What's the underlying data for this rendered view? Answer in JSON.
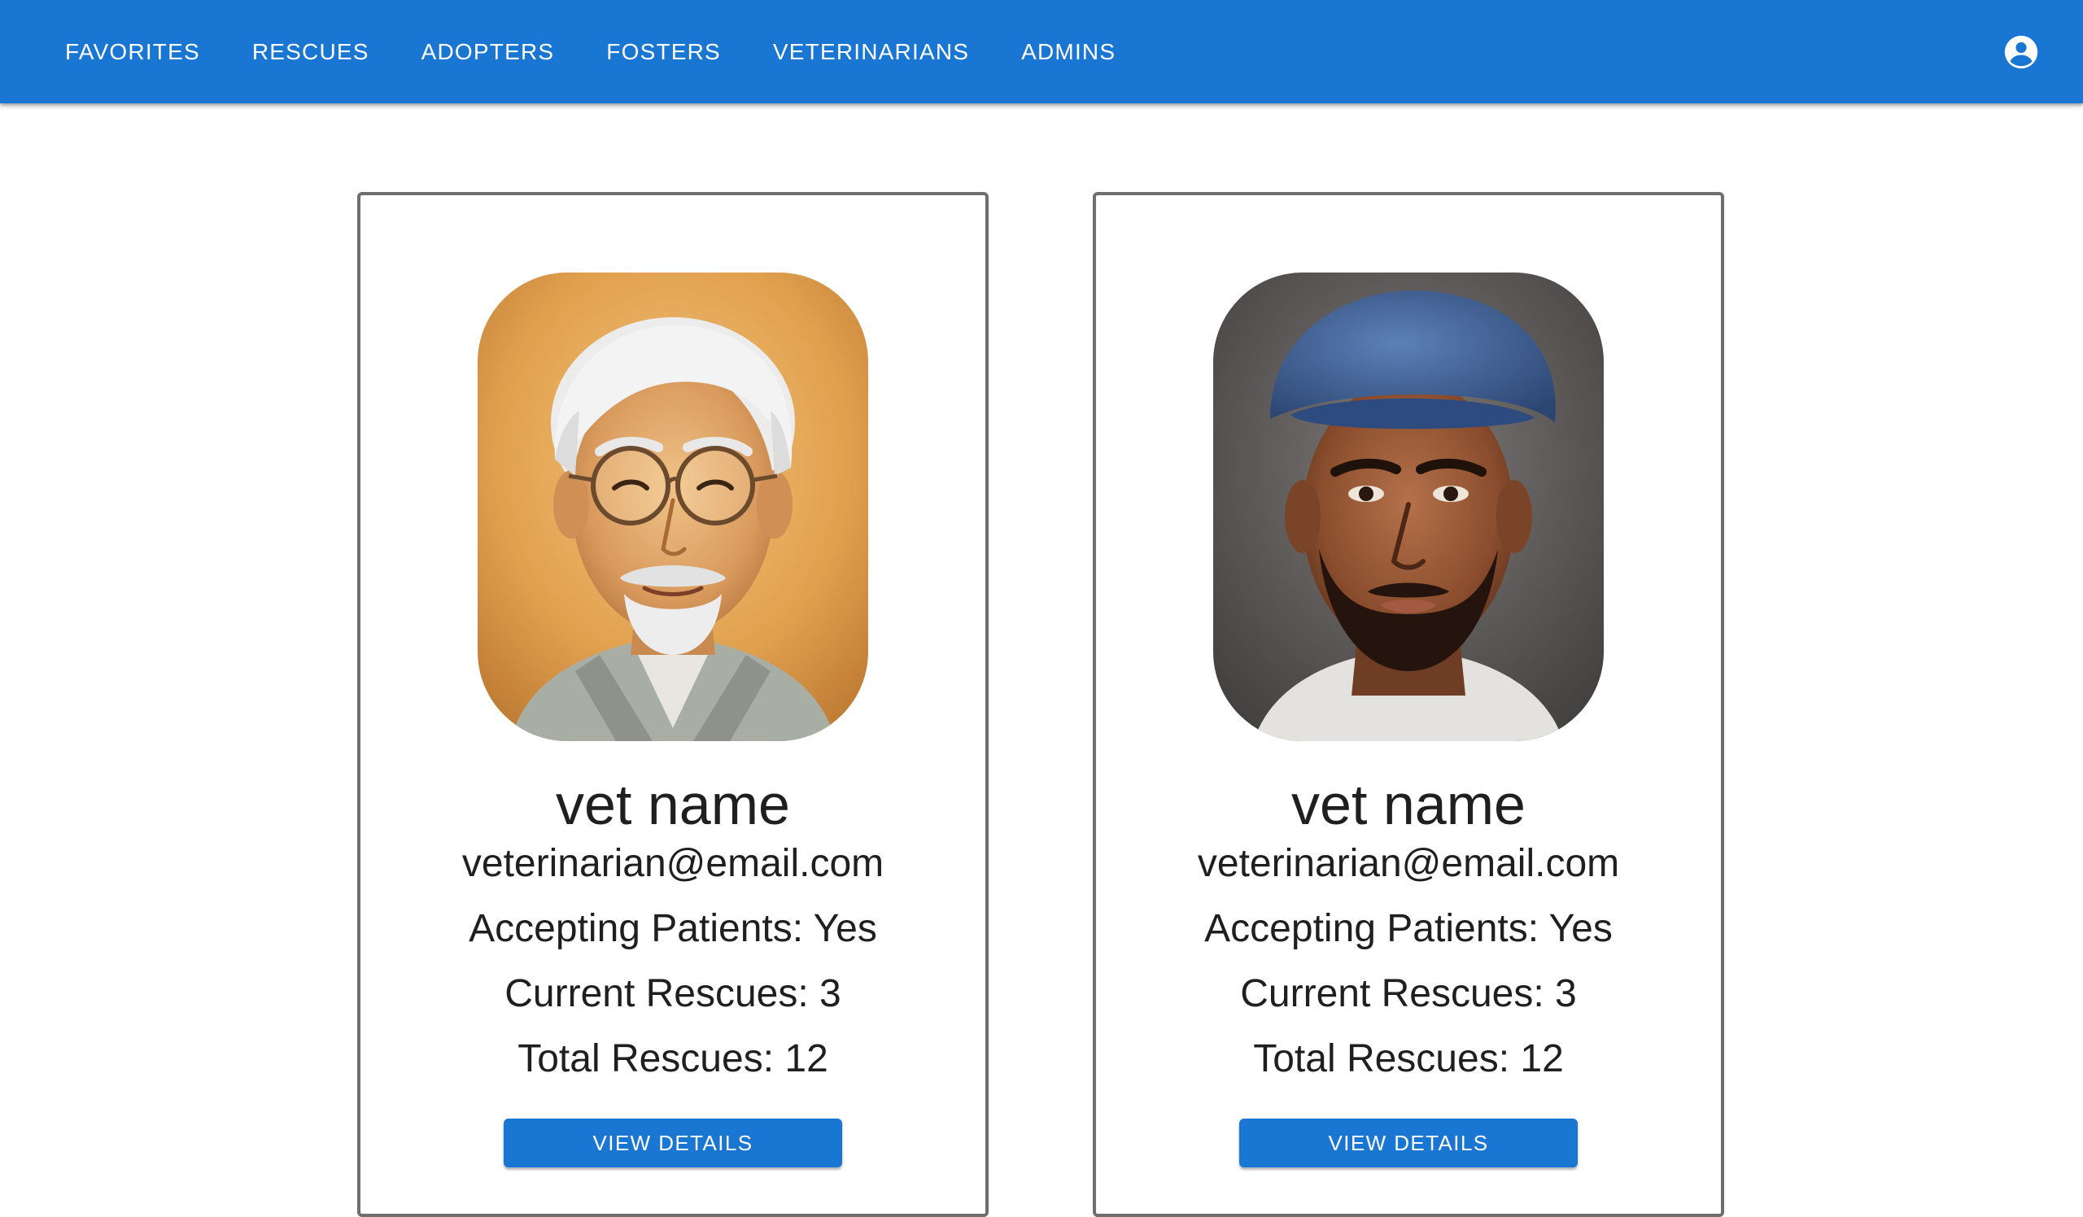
{
  "nav": {
    "items": [
      {
        "label": "FAVORITES"
      },
      {
        "label": "RESCUES"
      },
      {
        "label": "ADOPTERS"
      },
      {
        "label": "FOSTERS"
      },
      {
        "label": "VETERINARIANS"
      },
      {
        "label": "ADMINS"
      }
    ],
    "account_icon": "account-circle-icon"
  },
  "colors": {
    "primary": "#1976d2",
    "card_border": "#6e6e6e",
    "text": "#1f1f1f"
  },
  "vets": [
    {
      "photo": "older-man-with-glasses-portrait",
      "name": "vet name",
      "email": "veterinarian@email.com",
      "accepting": "Accepting Patients: Yes",
      "current": "Current Rescues: 3",
      "total": "Total Rescues: 12",
      "button": "VIEW DETAILS"
    },
    {
      "photo": "man-with-blue-cap-portrait",
      "name": "vet name",
      "email": "veterinarian@email.com",
      "accepting": "Accepting Patients: Yes",
      "current": "Current Rescues: 3",
      "total": "Total Rescues: 12",
      "button": "VIEW DETAILS"
    }
  ]
}
